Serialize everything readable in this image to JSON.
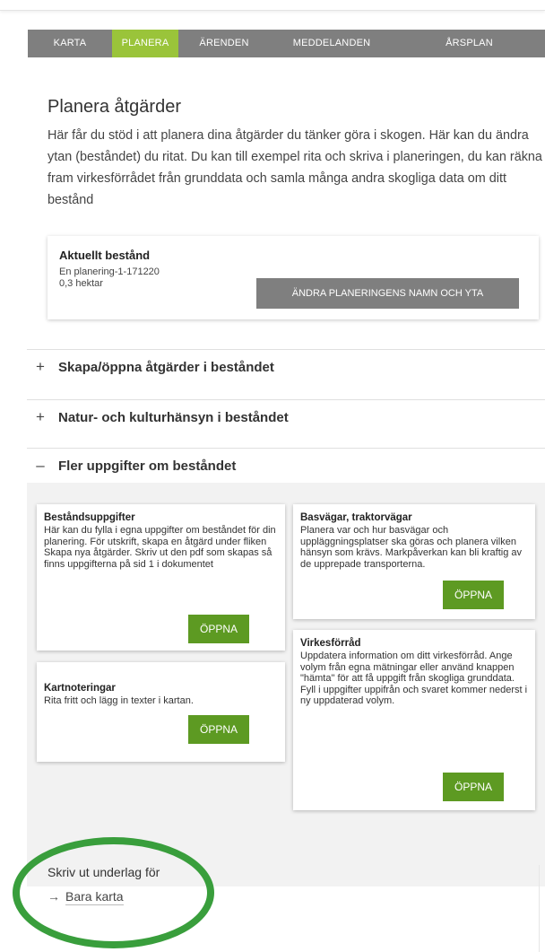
{
  "nav": {
    "tabs": [
      {
        "label": "KARTA"
      },
      {
        "label": "PLANERA",
        "active": true
      },
      {
        "label": "ÄRENDEN"
      },
      {
        "label": "MEDDELANDEN"
      },
      {
        "label": "ÅRSPLAN"
      }
    ]
  },
  "page": {
    "title": "Planera åtgärder",
    "intro": "Här får du stöd i att planera dina åtgärder du tänker göra i skogen. Här kan du ändra ytan (beståndet) du ritat. Du kan till exempel rita och skriva i planeringen, du kan räkna fram virkesförrådet från grunddata och samla många andra skogliga data om ditt bestånd"
  },
  "current_stand": {
    "title": "Aktuellt bestånd",
    "name": "En planering-1-171220",
    "size": "0,3 hektar",
    "rename_button": "ÄNDRA PLANERINGENS NAMN OCH YTA"
  },
  "sections": [
    {
      "sign": "+",
      "label": "Skapa/öppna åtgärder i beståndet"
    },
    {
      "sign": "+",
      "label": "Natur- och kulturhänsyn i beståndet"
    },
    {
      "sign": "–",
      "label": "Fler uppgifter om beståndet"
    }
  ],
  "cards": [
    {
      "title": "Beståndsuppgifter",
      "body": "Här kan du fylla i egna uppgifter om beståndet för din planering. För utskrift, skapa en åtgärd under fliken Skapa nya åtgärder. Skriv ut den pdf som skapas så finns uppgifterna på sid 1 i dokumentet",
      "button": "ÖPPNA"
    },
    {
      "title": "Basvägar, traktorvägar",
      "body": "Planera var och hur basvägar och uppläggningsplatser ska göras och planera vilken hänsyn som krävs. Markpåverkan kan bli kraftig av de upprepade transporterna.",
      "button": "ÖPPNA"
    },
    {
      "title": "Kartnoteringar",
      "body": "Rita fritt och lägg in texter i kartan.",
      "button": "ÖPPNA"
    },
    {
      "title": "Virkesförråd",
      "body": "Uppdatera information om ditt virkesförråd. Ange volym från egna mätningar eller använd knappen \"hämta\" för att få uppgift från skogliga grunddata. Fyll i uppgifter uppifrån och svaret kommer nederst i ny uppdaterad volym.",
      "button": "ÖPPNA"
    }
  ],
  "print": {
    "title": "Skriv ut underlag för",
    "arrow_icon": "arrow-right-icon",
    "link": "Bara karta"
  },
  "colors": {
    "nav_background": "#7f7f7f",
    "active_tab": "#9ac43a",
    "open_button": "#5d9a22",
    "highlight_ring": "#399e3c"
  }
}
